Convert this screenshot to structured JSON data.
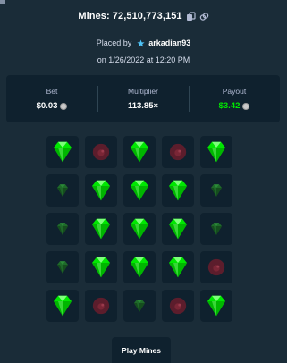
{
  "header": {
    "mines_label": "Mines:",
    "game_id": "72,510,773,151"
  },
  "placed": {
    "prefix": "Placed by",
    "username": "arkadian93",
    "date_line": "on 1/26/2022 at 12:20 PM"
  },
  "stats": {
    "bet_label": "Bet",
    "bet_value": "$0.03",
    "multiplier_label": "Multiplier",
    "multiplier_value": "113.85×",
    "payout_label": "Payout",
    "payout_value": "$3.42"
  },
  "grid": [
    [
      "gem",
      "mine",
      "gem",
      "mine",
      "gem"
    ],
    [
      "gem-dim",
      "gem",
      "gem",
      "gem",
      "gem-dim"
    ],
    [
      "gem-dim",
      "gem",
      "gem",
      "gem",
      "gem-dim"
    ],
    [
      "gem-dim",
      "gem",
      "gem",
      "gem",
      "mine"
    ],
    [
      "gem",
      "mine",
      "gem-dim",
      "mine",
      "gem"
    ]
  ],
  "play_button_label": "Play Mines",
  "colors": {
    "background": "#1a2c38",
    "panel": "#0f212e",
    "gem": "#00e701",
    "gem_dim": "#1f6b2a",
    "mine": "#5c1d2c",
    "payout": "#00e701"
  },
  "icons": {
    "copy": "copy-icon",
    "link": "link-icon",
    "user": "star-icon",
    "coin": "coin-icon"
  }
}
